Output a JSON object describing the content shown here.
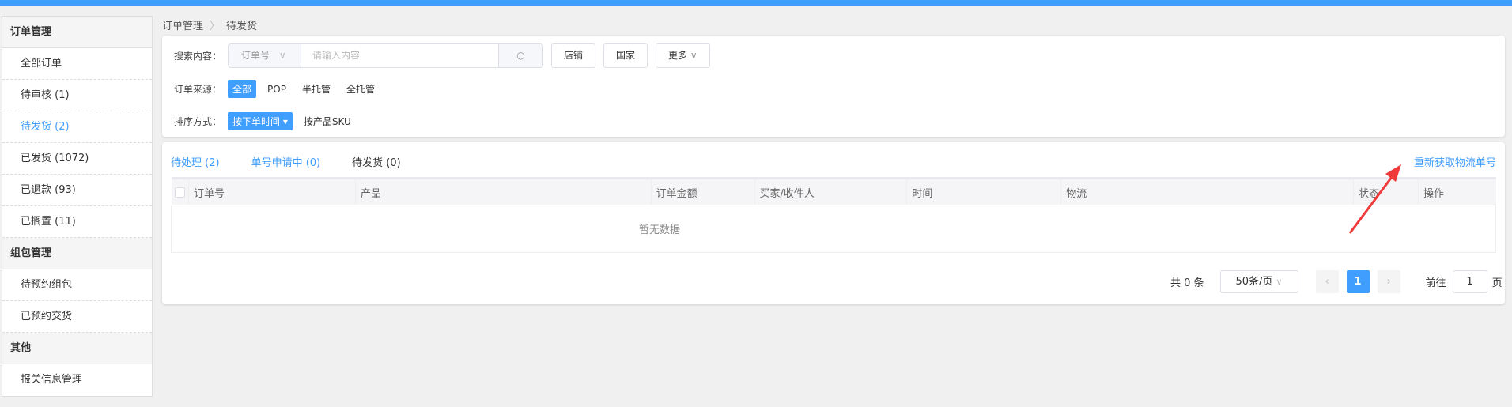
{
  "colors": {
    "accent": "#409eff",
    "arrow": "#f03a3a"
  },
  "sidebar": {
    "sections": [
      {
        "title": "订单管理",
        "items": [
          "全部订单",
          "待审核 (1)",
          "待发货 (2)",
          "已发货 (1072)",
          "已退款 (93)",
          "已搁置 (11)"
        ]
      },
      {
        "title": "组包管理",
        "items": [
          "待预约组包",
          "已预约交货"
        ]
      },
      {
        "title": "其他",
        "items": [
          "报关信息管理"
        ]
      }
    ],
    "active": "待发货 (2)"
  },
  "breadcrumb": [
    "订单管理",
    "待发货"
  ],
  "filters": {
    "search_label": "搜索内容：",
    "search_field": "订单号",
    "search_placeholder": "请输入内容",
    "buttons": [
      "店铺",
      "国家",
      "更多"
    ],
    "source_label": "订单来源：",
    "sources": [
      "全部",
      "POP",
      "半托管",
      "全托管"
    ],
    "sort_label": "排序方式：",
    "sorts": [
      "按下单时间",
      "按产品SKU"
    ]
  },
  "tabs": [
    "待处理 (2)",
    "单号申请中 (0)",
    "待发货 (0)"
  ],
  "refetch_link": "重新获取物流单号",
  "table": {
    "columns": [
      "订单号",
      "产品",
      "订单金额",
      "买家/收件人",
      "时间",
      "物流",
      "状态",
      "操作"
    ],
    "empty_text": "暂无数据"
  },
  "pagination": {
    "total": "共 0 条",
    "page_size": "50条/页",
    "current_page": "1",
    "goto_label": "前往",
    "goto_value": "1",
    "page_suffix": "页"
  }
}
